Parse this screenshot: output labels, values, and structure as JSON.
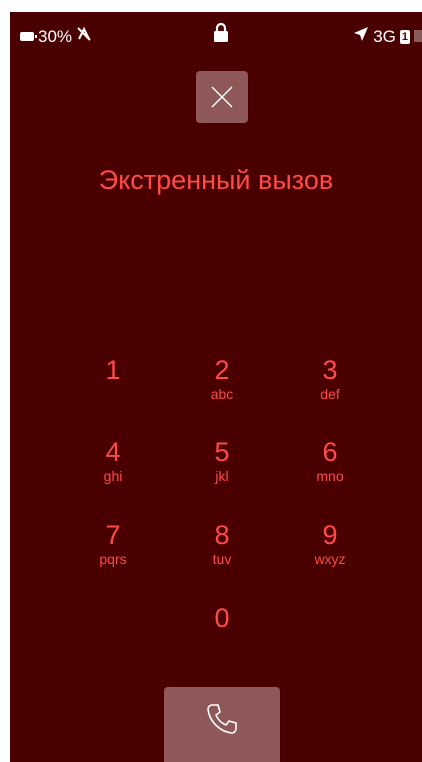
{
  "status_bar": {
    "battery_percent": "30%",
    "network": "3G",
    "sim_slot": "1",
    "icons": [
      "battery-icon",
      "no-signal-icon",
      "lock-icon",
      "airplane-icon",
      "sim-icon"
    ]
  },
  "close_button": {
    "icon": "close-icon"
  },
  "title": "Экстренный вызов",
  "keypad": [
    {
      "num": "1",
      "letters": ""
    },
    {
      "num": "2",
      "letters": "abc"
    },
    {
      "num": "3",
      "letters": "def"
    },
    {
      "num": "4",
      "letters": "ghi"
    },
    {
      "num": "5",
      "letters": "jkl"
    },
    {
      "num": "6",
      "letters": "mno"
    },
    {
      "num": "7",
      "letters": "pqrs"
    },
    {
      "num": "8",
      "letters": "tuv"
    },
    {
      "num": "9",
      "letters": "wxyz"
    },
    {
      "num": "0",
      "letters": ""
    }
  ],
  "call_button": {
    "icon": "phone-icon"
  },
  "colors": {
    "background": "#4a0000",
    "accent": "#ff4a4a",
    "button": "#8f5858"
  }
}
